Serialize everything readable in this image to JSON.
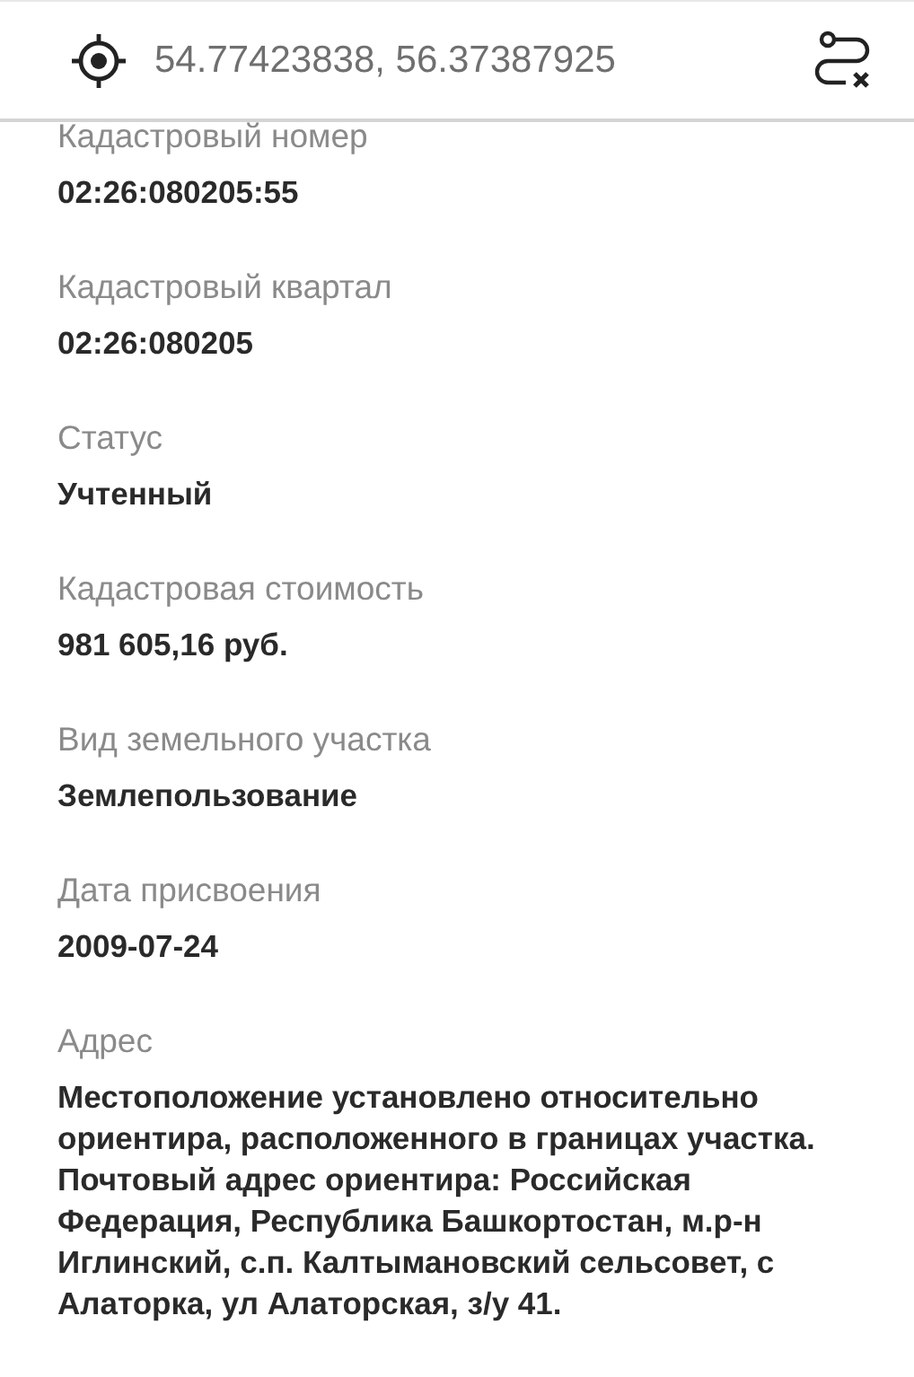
{
  "search": {
    "value": "54.77423838, 56.37387925"
  },
  "fields": [
    {
      "label": "Кадастровый номер",
      "value": "02:26:080205:55"
    },
    {
      "label": "Кадастровый квартал",
      "value": "02:26:080205"
    },
    {
      "label": "Статус",
      "value": "Учтенный"
    },
    {
      "label": "Кадастровая стоимость",
      "value": "981 605,16 руб."
    },
    {
      "label": "Вид земельного участка",
      "value": "Землепользование"
    },
    {
      "label": "Дата присвоения",
      "value": "2009-07-24"
    },
    {
      "label": "Адрес",
      "value": "Местоположение установлено относительно ориентира, расположенного в границах участка. Почтовый адрес ориентира: Российская Федерация, Республика Башкортостан, м.р-н Иглинский, с.п. Калтымановский сельсовет, с Алаторка, ул Алаторская, з/у 41."
    }
  ]
}
